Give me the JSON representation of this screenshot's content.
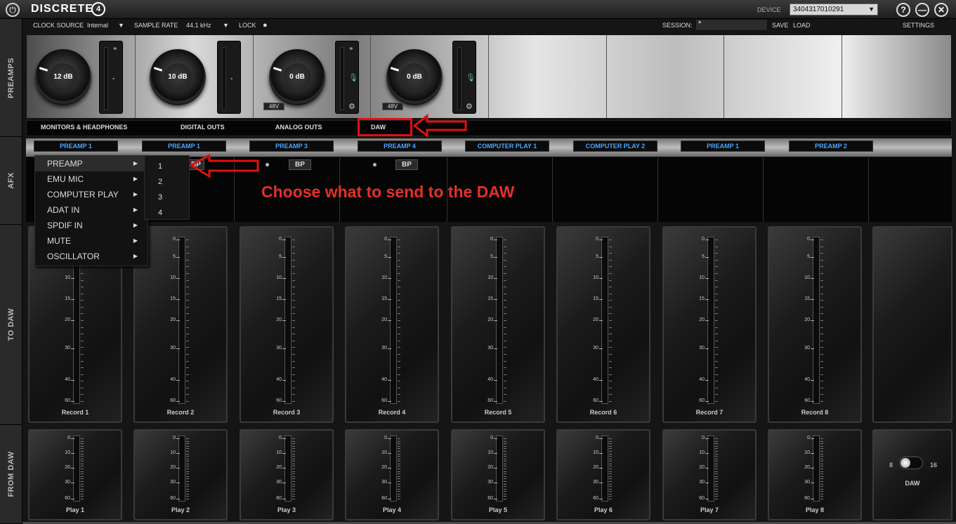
{
  "title_bar": {
    "logo": "DISCRETE",
    "logo_badge": "4",
    "device_label": "DEVICE",
    "device_value": "3404317010291"
  },
  "side_tabs": [
    "PREAMPS",
    "AFX",
    "TO DAW",
    "FROM DAW"
  ],
  "top_bar": {
    "clock_source_label": "CLOCK SOURCE",
    "clock_source_value": "Internal",
    "sample_rate_label": "SAMPLE RATE",
    "sample_rate_value": "44.1 kHz",
    "lock_label": "LOCK",
    "session_label": "SESSION:",
    "session_value": "*",
    "save": "SAVE",
    "load": "LOAD",
    "settings": "SETTINGS"
  },
  "preamps": [
    {
      "gain": "12 dB",
      "input_icon": "guitar-icon",
      "has_48v": false,
      "link": true
    },
    {
      "gain": "10 dB",
      "input_icon": "guitar-icon",
      "has_48v": false,
      "link": false
    },
    {
      "gain": "0 dB",
      "input_icon": "mic-icon",
      "has_48v": true,
      "phantom": "48V",
      "link": true
    },
    {
      "gain": "0 dB",
      "input_icon": "mic-icon",
      "has_48v": true,
      "phantom": "48V",
      "link": false
    }
  ],
  "output_tabs": [
    "MONITORS & HEADPHONES",
    "DIGITAL OUTS",
    "ANALOG OUTS",
    "DAW"
  ],
  "sources": [
    "PREAMP 1",
    "PREAMP 1",
    "PREAMP 3",
    "PREAMP 4",
    "COMPUTER PLAY 1",
    "COMPUTER PLAY 2",
    "PREAMP 1",
    "PREAMP 2"
  ],
  "afx": {
    "bp_label": "BP",
    "bp_partial": "BP"
  },
  "annotation": "Choose what to send to the DAW",
  "source_menu": {
    "items": [
      "PREAMP",
      "EMU MIC",
      "COMPUTER PLAY",
      "ADAT IN",
      "SPDIF IN",
      "MUTE",
      "OSCILLATOR"
    ],
    "submenu": [
      "1",
      "2",
      "3",
      "4"
    ]
  },
  "to_daw": {
    "channels": [
      "Record 1",
      "Record 2",
      "Record 3",
      "Record 4",
      "Record 5",
      "Record 6",
      "Record 7",
      "Record 8"
    ],
    "ticks": [
      "0",
      "5",
      "10",
      "15",
      "20",
      "30",
      "40",
      "60"
    ]
  },
  "from_daw": {
    "channels": [
      "Play 1",
      "Play 2",
      "Play 3",
      "Play 4",
      "Play 5",
      "Play 6",
      "Play 7",
      "Play 8"
    ],
    "ticks": [
      "0",
      "10",
      "20",
      "30",
      "60"
    ]
  },
  "daw_panel": {
    "left": "8",
    "right": "16",
    "label": "DAW"
  }
}
